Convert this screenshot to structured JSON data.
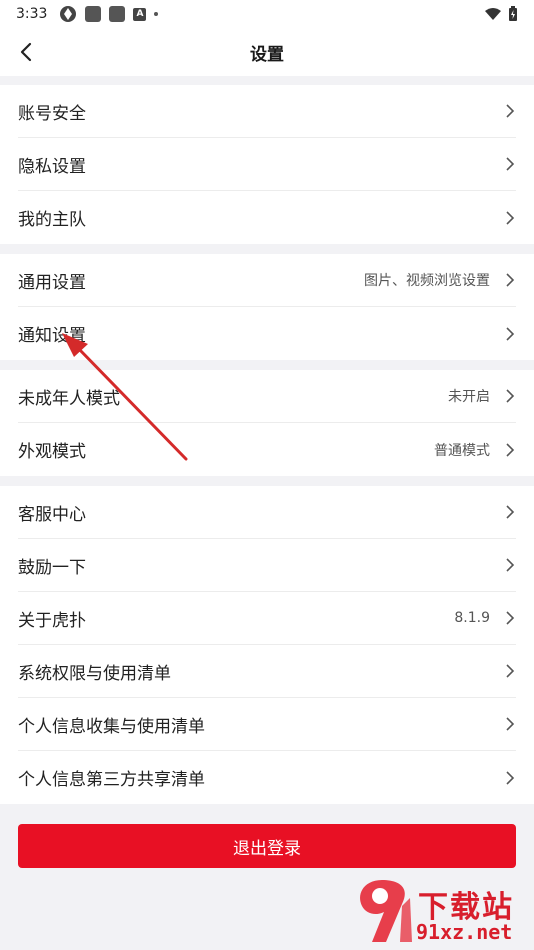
{
  "status_bar": {
    "time": "3:33",
    "notif_letter": "A"
  },
  "header": {
    "title": "设置"
  },
  "groups": [
    {
      "rows": [
        {
          "label": "账号安全"
        },
        {
          "label": "隐私设置"
        },
        {
          "label": "我的主队"
        }
      ]
    },
    {
      "rows": [
        {
          "label": "通用设置",
          "value": "图片、视频浏览设置"
        },
        {
          "label": "通知设置"
        }
      ]
    },
    {
      "rows": [
        {
          "label": "未成年人模式",
          "value": "未开启"
        },
        {
          "label": "外观模式",
          "value": "普通模式"
        }
      ]
    },
    {
      "rows": [
        {
          "label": "客服中心"
        },
        {
          "label": "鼓励一下"
        },
        {
          "label": "关于虎扑",
          "value": "8.1.9"
        },
        {
          "label": "系统权限与使用清单"
        },
        {
          "label": "个人信息收集与使用清单"
        },
        {
          "label": "个人信息第三方共享清单"
        }
      ]
    }
  ],
  "logout_label": "退出登录",
  "watermark": {
    "brand": "下载站",
    "url": "91xz.net"
  },
  "colors": {
    "accent": "#e81024",
    "background": "#f2f2f5",
    "annotation_arrow": "#d42a2a"
  }
}
